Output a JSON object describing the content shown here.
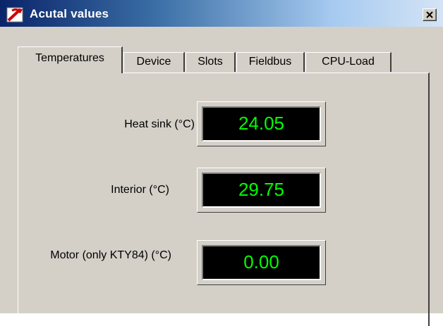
{
  "window": {
    "title": "Acutal values",
    "close_label": "×"
  },
  "tabs": [
    {
      "label": "Temperatures",
      "active": true
    },
    {
      "label": "Device",
      "active": false
    },
    {
      "label": "Slots",
      "active": false
    },
    {
      "label": "Fieldbus",
      "active": false
    },
    {
      "label": "CPU-Load",
      "active": false
    }
  ],
  "temperatures": {
    "heat_sink": {
      "label": "Heat sink (°C)",
      "value": "24.05"
    },
    "interior": {
      "label": "Interior (°C)",
      "value": "29.75"
    },
    "motor": {
      "label": "Motor (only KTY84)  (°C)",
      "value": "0.00"
    }
  },
  "colors": {
    "window_bg": "#d4d0c8",
    "titlebar_start": "#0a246a",
    "titlebar_end": "#d4e4f5",
    "display_bg": "#000000",
    "display_text": "#00ff00"
  },
  "icons": {
    "app": "app-logo-icon",
    "close": "close-icon"
  }
}
